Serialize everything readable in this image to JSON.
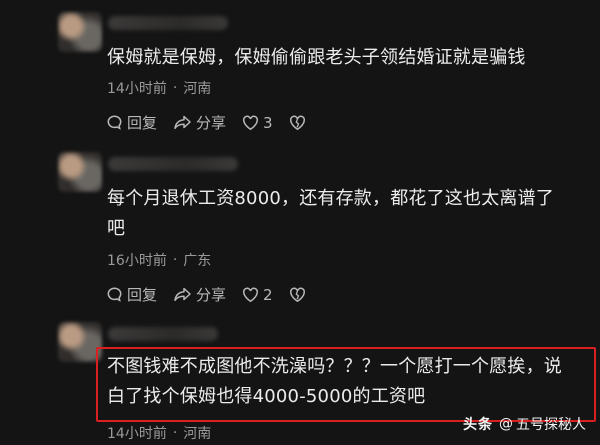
{
  "comments": [
    {
      "text_lines": [
        "保姆就是保姆，保姆偷偷跟老头子领结婚证就是骗钱"
      ],
      "time": "14小时前",
      "separator": "·",
      "location": "河南",
      "reply_label": "回复",
      "share_label": "分享",
      "like_count": "3",
      "dislike_count": ""
    },
    {
      "text_lines": [
        "每个月退休工资8000，还有存款，都花了这也太离谱了",
        "吧"
      ],
      "time": "16小时前",
      "separator": "·",
      "location": "广东",
      "reply_label": "回复",
      "share_label": "分享",
      "like_count": "2",
      "dislike_count": ""
    },
    {
      "text_lines": [
        "不图钱难不成图他不洗澡吗？？？一个愿打一个愿挨，说",
        "白了找个保姆也得4000-5000的工资吧"
      ],
      "time": "14小时前",
      "separator": "·",
      "location": "河南"
    }
  ],
  "watermark": {
    "brand": "头条",
    "at": "@",
    "account": "五号探秘人"
  },
  "colors": {
    "background": "#141414",
    "text": "#ececec",
    "meta": "#9a9a9a",
    "highlight_border": "#d91f1f"
  },
  "icons": [
    "reply-icon",
    "share-icon",
    "like-icon",
    "dislike-icon"
  ]
}
